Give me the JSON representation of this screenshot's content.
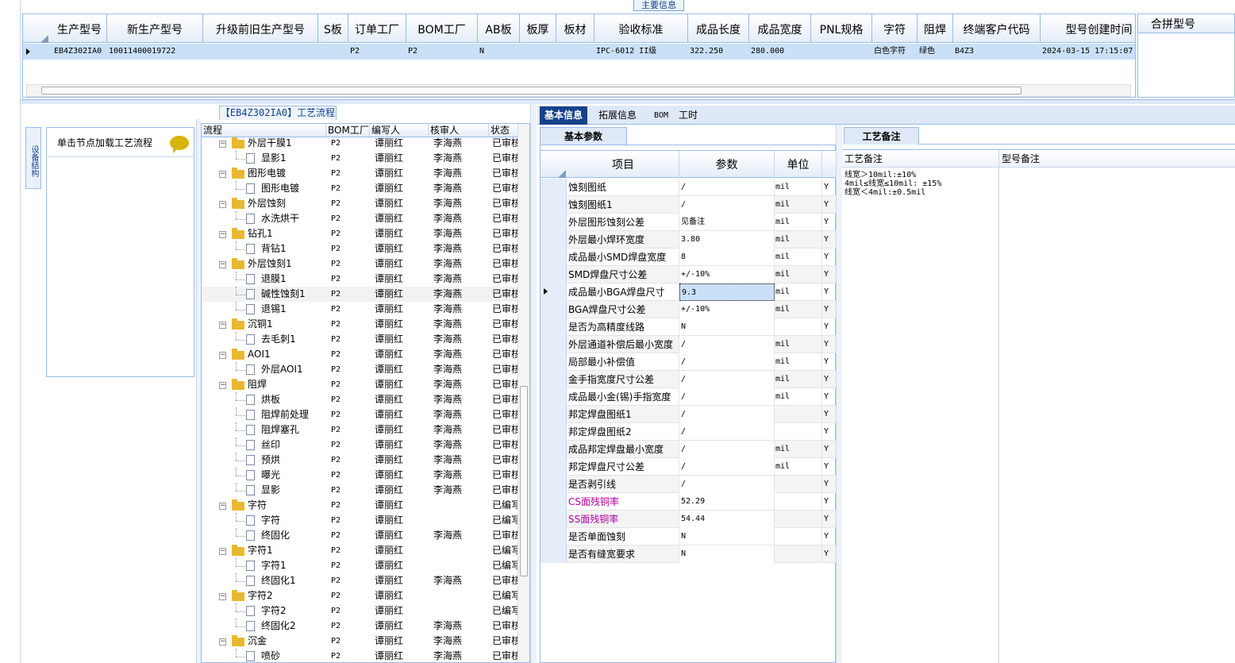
{
  "main_info": {
    "caption": "主要信息",
    "columns": [
      "生产型号",
      "新生产型号",
      "升级前旧生产型号",
      "S板",
      "订单工厂",
      "BOM工厂",
      "AB板",
      "板厚",
      "板材",
      "验收标准",
      "成品长度",
      "成品宽度",
      "PNL规格",
      "字符",
      "阻焊",
      "终端客户代码",
      "型号创建时间"
    ],
    "row": [
      "EB4Z302IA0",
      "10011400019722",
      "",
      "",
      "P2",
      "P2",
      "N",
      "",
      "",
      "IPC-6012 II级",
      "322.250",
      "280.000",
      "",
      "白色字符",
      "绿色",
      "B4Z3",
      "2024-03-15 17:15:07"
    ],
    "merge_header": "合拼型号"
  },
  "flow": {
    "caption": "【EB4Z302IA0】工艺流程",
    "side_tab": "设备结构",
    "tip": "单击节点加载工艺流程",
    "columns": [
      "流程",
      "BOM工厂",
      "编写人",
      "核审人",
      "状态"
    ],
    "rows": [
      {
        "level": 0,
        "type": "folder",
        "name": "外层干膜1",
        "bom": "P2",
        "author": "谭丽红",
        "reviewer": "李海燕",
        "status": "已审核"
      },
      {
        "level": 1,
        "type": "doc",
        "name": "显影1",
        "bom": "P2",
        "author": "谭丽红",
        "reviewer": "李海燕",
        "status": "已审核"
      },
      {
        "level": 0,
        "type": "folder",
        "name": "图形电镀",
        "bom": "P2",
        "author": "谭丽红",
        "reviewer": "李海燕",
        "status": "已审核"
      },
      {
        "level": 1,
        "type": "doc",
        "name": "图形电镀",
        "bom": "P2",
        "author": "谭丽红",
        "reviewer": "李海燕",
        "status": "已审核"
      },
      {
        "level": 0,
        "type": "folder",
        "name": "外层蚀刻",
        "bom": "P2",
        "author": "谭丽红",
        "reviewer": "李海燕",
        "status": "已审核"
      },
      {
        "level": 1,
        "type": "doc",
        "name": "水洗烘干",
        "bom": "P2",
        "author": "谭丽红",
        "reviewer": "李海燕",
        "status": "已审核"
      },
      {
        "level": 0,
        "type": "folder",
        "name": "钻孔1",
        "bom": "P2",
        "author": "谭丽红",
        "reviewer": "李海燕",
        "status": "已审核"
      },
      {
        "level": 1,
        "type": "doc",
        "name": "背钻1",
        "bom": "P2",
        "author": "谭丽红",
        "reviewer": "李海燕",
        "status": "已审核"
      },
      {
        "level": 0,
        "type": "folder",
        "name": "外层蚀刻1",
        "bom": "P2",
        "author": "谭丽红",
        "reviewer": "李海燕",
        "status": "已审核"
      },
      {
        "level": 1,
        "type": "doc",
        "name": "退膜1",
        "bom": "P2",
        "author": "谭丽红",
        "reviewer": "李海燕",
        "status": "已审核"
      },
      {
        "level": 1,
        "type": "doc",
        "name": "碱性蚀刻1",
        "bom": "P2",
        "author": "谭丽红",
        "reviewer": "李海燕",
        "status": "已审核",
        "selected": true
      },
      {
        "level": 1,
        "type": "doc",
        "name": "退锡1",
        "bom": "P2",
        "author": "谭丽红",
        "reviewer": "李海燕",
        "status": "已审核"
      },
      {
        "level": 0,
        "type": "folder",
        "name": "沉铜1",
        "bom": "P2",
        "author": "谭丽红",
        "reviewer": "李海燕",
        "status": "已审核"
      },
      {
        "level": 1,
        "type": "doc",
        "name": "去毛刺1",
        "bom": "P2",
        "author": "谭丽红",
        "reviewer": "李海燕",
        "status": "已审核"
      },
      {
        "level": 0,
        "type": "folder",
        "name": "AOI1",
        "bom": "P2",
        "author": "谭丽红",
        "reviewer": "李海燕",
        "status": "已审核"
      },
      {
        "level": 1,
        "type": "doc",
        "name": "外层AOI1",
        "bom": "P2",
        "author": "谭丽红",
        "reviewer": "李海燕",
        "status": "已审核"
      },
      {
        "level": 0,
        "type": "folder",
        "name": "阻焊",
        "bom": "P2",
        "author": "谭丽红",
        "reviewer": "李海燕",
        "status": "已审核"
      },
      {
        "level": 1,
        "type": "doc",
        "name": "烘板",
        "bom": "P2",
        "author": "谭丽红",
        "reviewer": "李海燕",
        "status": "已审核"
      },
      {
        "level": 1,
        "type": "doc",
        "name": "阻焊前处理",
        "bom": "P2",
        "author": "谭丽红",
        "reviewer": "李海燕",
        "status": "已审核"
      },
      {
        "level": 1,
        "type": "doc",
        "name": "阻焊塞孔",
        "bom": "P2",
        "author": "谭丽红",
        "reviewer": "李海燕",
        "status": "已审核"
      },
      {
        "level": 1,
        "type": "doc",
        "name": "丝印",
        "bom": "P2",
        "author": "谭丽红",
        "reviewer": "李海燕",
        "status": "已审核"
      },
      {
        "level": 1,
        "type": "doc",
        "name": "预烘",
        "bom": "P2",
        "author": "谭丽红",
        "reviewer": "李海燕",
        "status": "已审核"
      },
      {
        "level": 1,
        "type": "doc",
        "name": "曝光",
        "bom": "P2",
        "author": "谭丽红",
        "reviewer": "李海燕",
        "status": "已审核"
      },
      {
        "level": 1,
        "type": "doc",
        "name": "显影",
        "bom": "P2",
        "author": "谭丽红",
        "reviewer": "李海燕",
        "status": "已审核"
      },
      {
        "level": 0,
        "type": "folder",
        "name": "字符",
        "bom": "P2",
        "author": "谭丽红",
        "reviewer": "",
        "status": "已编写"
      },
      {
        "level": 1,
        "type": "doc",
        "name": "字符",
        "bom": "P2",
        "author": "谭丽红",
        "reviewer": "",
        "status": "已编写"
      },
      {
        "level": 1,
        "type": "doc",
        "name": "终固化",
        "bom": "P2",
        "author": "谭丽红",
        "reviewer": "李海燕",
        "status": "已审核"
      },
      {
        "level": 0,
        "type": "folder",
        "name": "字符1",
        "bom": "P2",
        "author": "谭丽红",
        "reviewer": "",
        "status": "已编写"
      },
      {
        "level": 1,
        "type": "doc",
        "name": "字符1",
        "bom": "P2",
        "author": "谭丽红",
        "reviewer": "",
        "status": "已编写"
      },
      {
        "level": 1,
        "type": "doc",
        "name": "终固化1",
        "bom": "P2",
        "author": "谭丽红",
        "reviewer": "李海燕",
        "status": "已审核"
      },
      {
        "level": 0,
        "type": "folder",
        "name": "字符2",
        "bom": "P2",
        "author": "谭丽红",
        "reviewer": "",
        "status": "已编写"
      },
      {
        "level": 1,
        "type": "doc",
        "name": "字符2",
        "bom": "P2",
        "author": "谭丽红",
        "reviewer": "",
        "status": "已编写"
      },
      {
        "level": 1,
        "type": "doc",
        "name": "终固化2",
        "bom": "P2",
        "author": "谭丽红",
        "reviewer": "李海燕",
        "status": "已审核"
      },
      {
        "level": 0,
        "type": "folder",
        "name": "沉金",
        "bom": "P2",
        "author": "谭丽红",
        "reviewer": "李海燕",
        "status": "已审核"
      },
      {
        "level": 1,
        "type": "doc",
        "name": "喷砂",
        "bom": "P2",
        "author": "谭丽红",
        "reviewer": "李海燕",
        "status": "已审核"
      }
    ]
  },
  "tabs": [
    "基本信息",
    "拓展信息",
    "BOM",
    "工时"
  ],
  "basic_params": {
    "tab": "基本参数",
    "columns": [
      "项目",
      "参数",
      "单位"
    ],
    "rows": [
      {
        "name": "蚀刻图纸",
        "value": "/",
        "unit": "mil",
        "flag": "Y"
      },
      {
        "name": "蚀刻图纸1",
        "value": "/",
        "unit": "mil",
        "flag": "Y"
      },
      {
        "name": "外层图形蚀刻公差",
        "value": "见备注",
        "unit": "mil",
        "flag": "Y"
      },
      {
        "name": "外层最小焊环宽度",
        "value": "3.80",
        "unit": "mil",
        "flag": "Y"
      },
      {
        "name": "成品最小SMD焊盘宽度",
        "value": "8",
        "unit": "mil",
        "flag": "Y"
      },
      {
        "name": "SMD焊盘尺寸公差",
        "value": "+/-10%",
        "unit": "mil",
        "flag": "Y"
      },
      {
        "name": "成品最小BGA焊盘尺寸",
        "value": "9.3",
        "unit": "mil",
        "flag": "Y",
        "current": true
      },
      {
        "name": "BGA焊盘尺寸公差",
        "value": "+/-10%",
        "unit": "mil",
        "flag": "Y"
      },
      {
        "name": "是否为高精度线路",
        "value": "N",
        "unit": "",
        "flag": "Y"
      },
      {
        "name": "外层通道补偿后最小宽度",
        "value": "/",
        "unit": "mil",
        "flag": "Y"
      },
      {
        "name": "局部最小补偿值",
        "value": "/",
        "unit": "mil",
        "flag": "Y"
      },
      {
        "name": "金手指宽度尺寸公差",
        "value": "/",
        "unit": "mil",
        "flag": "Y"
      },
      {
        "name": "成品最小金(锡)手指宽度",
        "value": "/",
        "unit": "mil",
        "flag": "Y"
      },
      {
        "name": "邦定焊盘图纸1",
        "value": "/",
        "unit": "",
        "flag": "Y"
      },
      {
        "name": "邦定焊盘图纸2",
        "value": "/",
        "unit": "",
        "flag": "Y"
      },
      {
        "name": "成品邦定焊盘最小宽度",
        "value": "/",
        "unit": "mil",
        "flag": "Y"
      },
      {
        "name": "邦定焊盘尺寸公差",
        "value": "/",
        "unit": "mil",
        "flag": "Y"
      },
      {
        "name": "是否剥引线",
        "value": "/",
        "unit": "",
        "flag": "Y"
      },
      {
        "name": "CS面残铜率",
        "value": "52.29",
        "unit": "",
        "flag": "Y",
        "highlight": true
      },
      {
        "name": "SS面残铜率",
        "value": "54.44",
        "unit": "",
        "flag": "Y",
        "highlight": true
      },
      {
        "name": "是否单面蚀刻",
        "value": "N",
        "unit": "",
        "flag": "Y"
      },
      {
        "name": "是否有缝宽要求",
        "value": "N",
        "unit": "",
        "flag": "Y"
      }
    ]
  },
  "craft_notes": {
    "tab": "工艺备注",
    "col1": "工艺备注",
    "col2": "型号备注",
    "lines": [
      "线宽＞10mil:±10%",
      "4mil≤线宽≤10mil: ±15%",
      "线宽＜4mil:±0.5mil"
    ]
  },
  "colors": {
    "accent": "#15428b",
    "border": "#99bbe8",
    "highlight_text": "#b0009a",
    "selection": "#c9e0f7",
    "folder": "#e8b830"
  }
}
